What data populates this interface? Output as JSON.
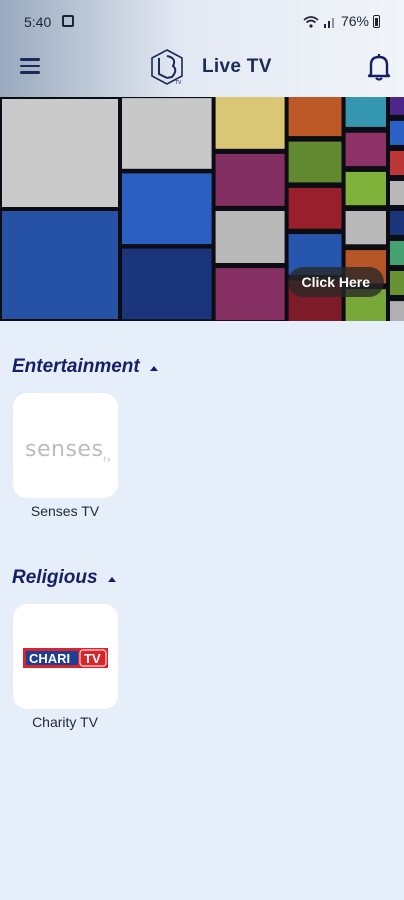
{
  "status_bar": {
    "time": "5:40",
    "battery": "76%",
    "icons": [
      "photo-icon",
      "wifi-icon",
      "signal-icon",
      "battery-icon"
    ]
  },
  "app_bar": {
    "title": "Live TV",
    "logo_text": "TV",
    "icons": [
      "menu-icon",
      "bell-icon"
    ]
  },
  "hero": {
    "button_label": "Click Here"
  },
  "sections": [
    {
      "title": "Entertainment",
      "channels": [
        {
          "name": "Senses TV",
          "logo_text": "senses",
          "logo_suffix": "tv"
        }
      ]
    },
    {
      "title": "Religious",
      "channels": [
        {
          "name": "Charity TV",
          "logo_text": "CHARI",
          "logo_suffix": "TV"
        }
      ]
    }
  ],
  "colors": {
    "accent": "#16206a",
    "background": "#e6eef9",
    "charity_red": "#d7262b",
    "charity_blue": "#1c3f94"
  }
}
